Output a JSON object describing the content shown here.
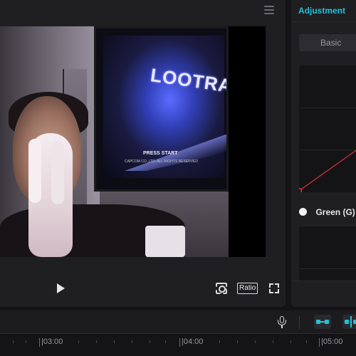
{
  "player": {
    "menu_icon": "hamburger-menu-icon",
    "controls": {
      "play_icon": "play-icon",
      "snapshot_icon": "snapshot-focus-icon",
      "ratio_label": "Ratio",
      "fullscreen_icon": "fullscreen-icon"
    },
    "video_overlay_text": {
      "tv_logo": "LOOTRA",
      "press_start": "PRESS START",
      "copyright": "CAPCOM CO.,LTD. ALL RIGHTS RESERVED"
    }
  },
  "adjustment": {
    "title": "Adjustment",
    "tab_basic": "Basic",
    "channel_label": "Green (G)",
    "colors": {
      "accent": "#22c1d6",
      "curve": "#e0323c"
    }
  },
  "timeline": {
    "tools": [
      "microphone-icon",
      "link-clips-icon",
      "split-icon"
    ],
    "ruler_labels": [
      "03:00",
      "04:00",
      "05:00"
    ]
  }
}
